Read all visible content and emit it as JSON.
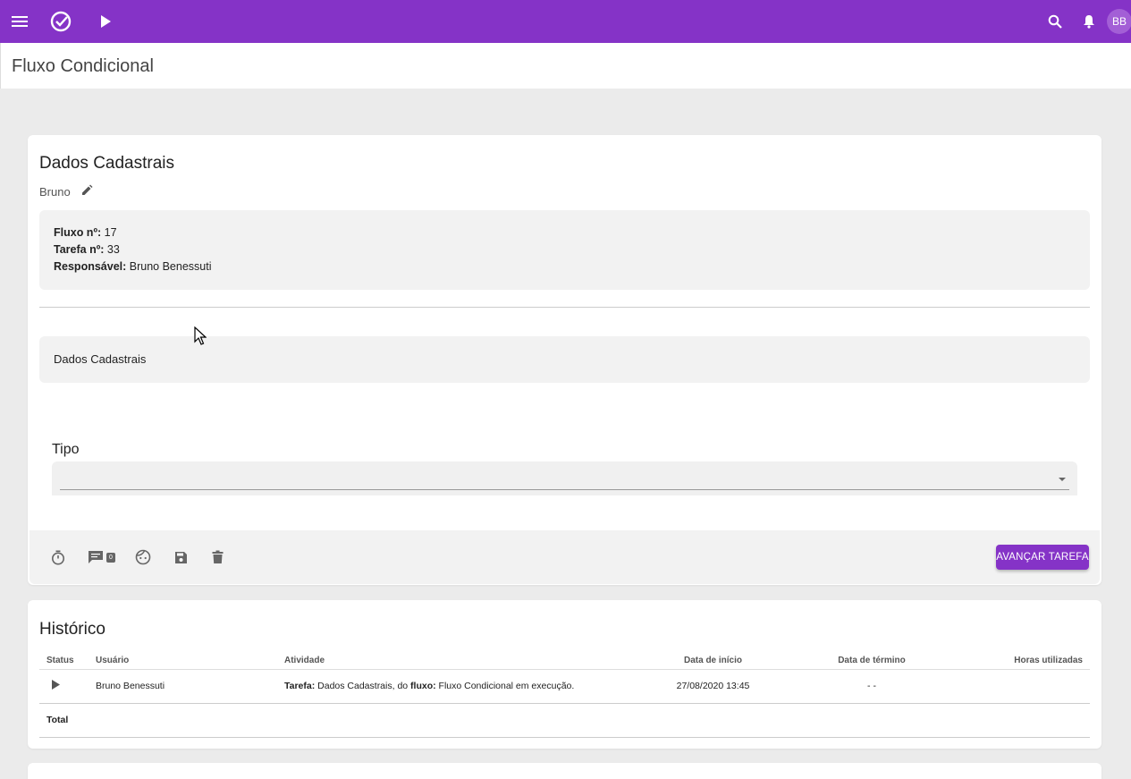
{
  "topbar": {
    "menu_icon": "menu-icon",
    "logo_icon": "check-circle-icon",
    "play_icon": "play-icon",
    "search_icon": "search-icon",
    "bell_icon": "bell-icon",
    "avatar_initials": "BB",
    "color": "#8533c7"
  },
  "page": {
    "title": "Fluxo Condicional"
  },
  "task_card": {
    "title": "Dados Cadastrais",
    "owner": "Bruno",
    "info": {
      "flow_label": "Fluxo nº:",
      "flow_value": "17",
      "task_label": "Tarefa nº:",
      "task_value": "33",
      "resp_label": "Responsável:",
      "resp_value": "Bruno Benessuti"
    },
    "section_title": "Dados Cadastrais",
    "tipo_label": "Tipo",
    "tipo_value": "",
    "actions": {
      "comment_count": "0",
      "advance_label": "AVANÇAR TAREFA"
    }
  },
  "history": {
    "title": "Histórico",
    "columns": [
      "Status",
      "Usuário",
      "Atividade",
      "Data de início",
      "Data de término",
      "Horas utilizadas"
    ],
    "rows": [
      {
        "user": "Bruno Benessuti",
        "activity_prefix": "Tarefa:",
        "activity_mid": " Dados Cadastrais, do ",
        "activity_flow_label": "fluxo:",
        "activity_suffix": " Fluxo Condicional em execução.",
        "start": "27/08/2020 13:45",
        "end": "- -",
        "hours": ""
      }
    ],
    "total_label": "Total"
  }
}
